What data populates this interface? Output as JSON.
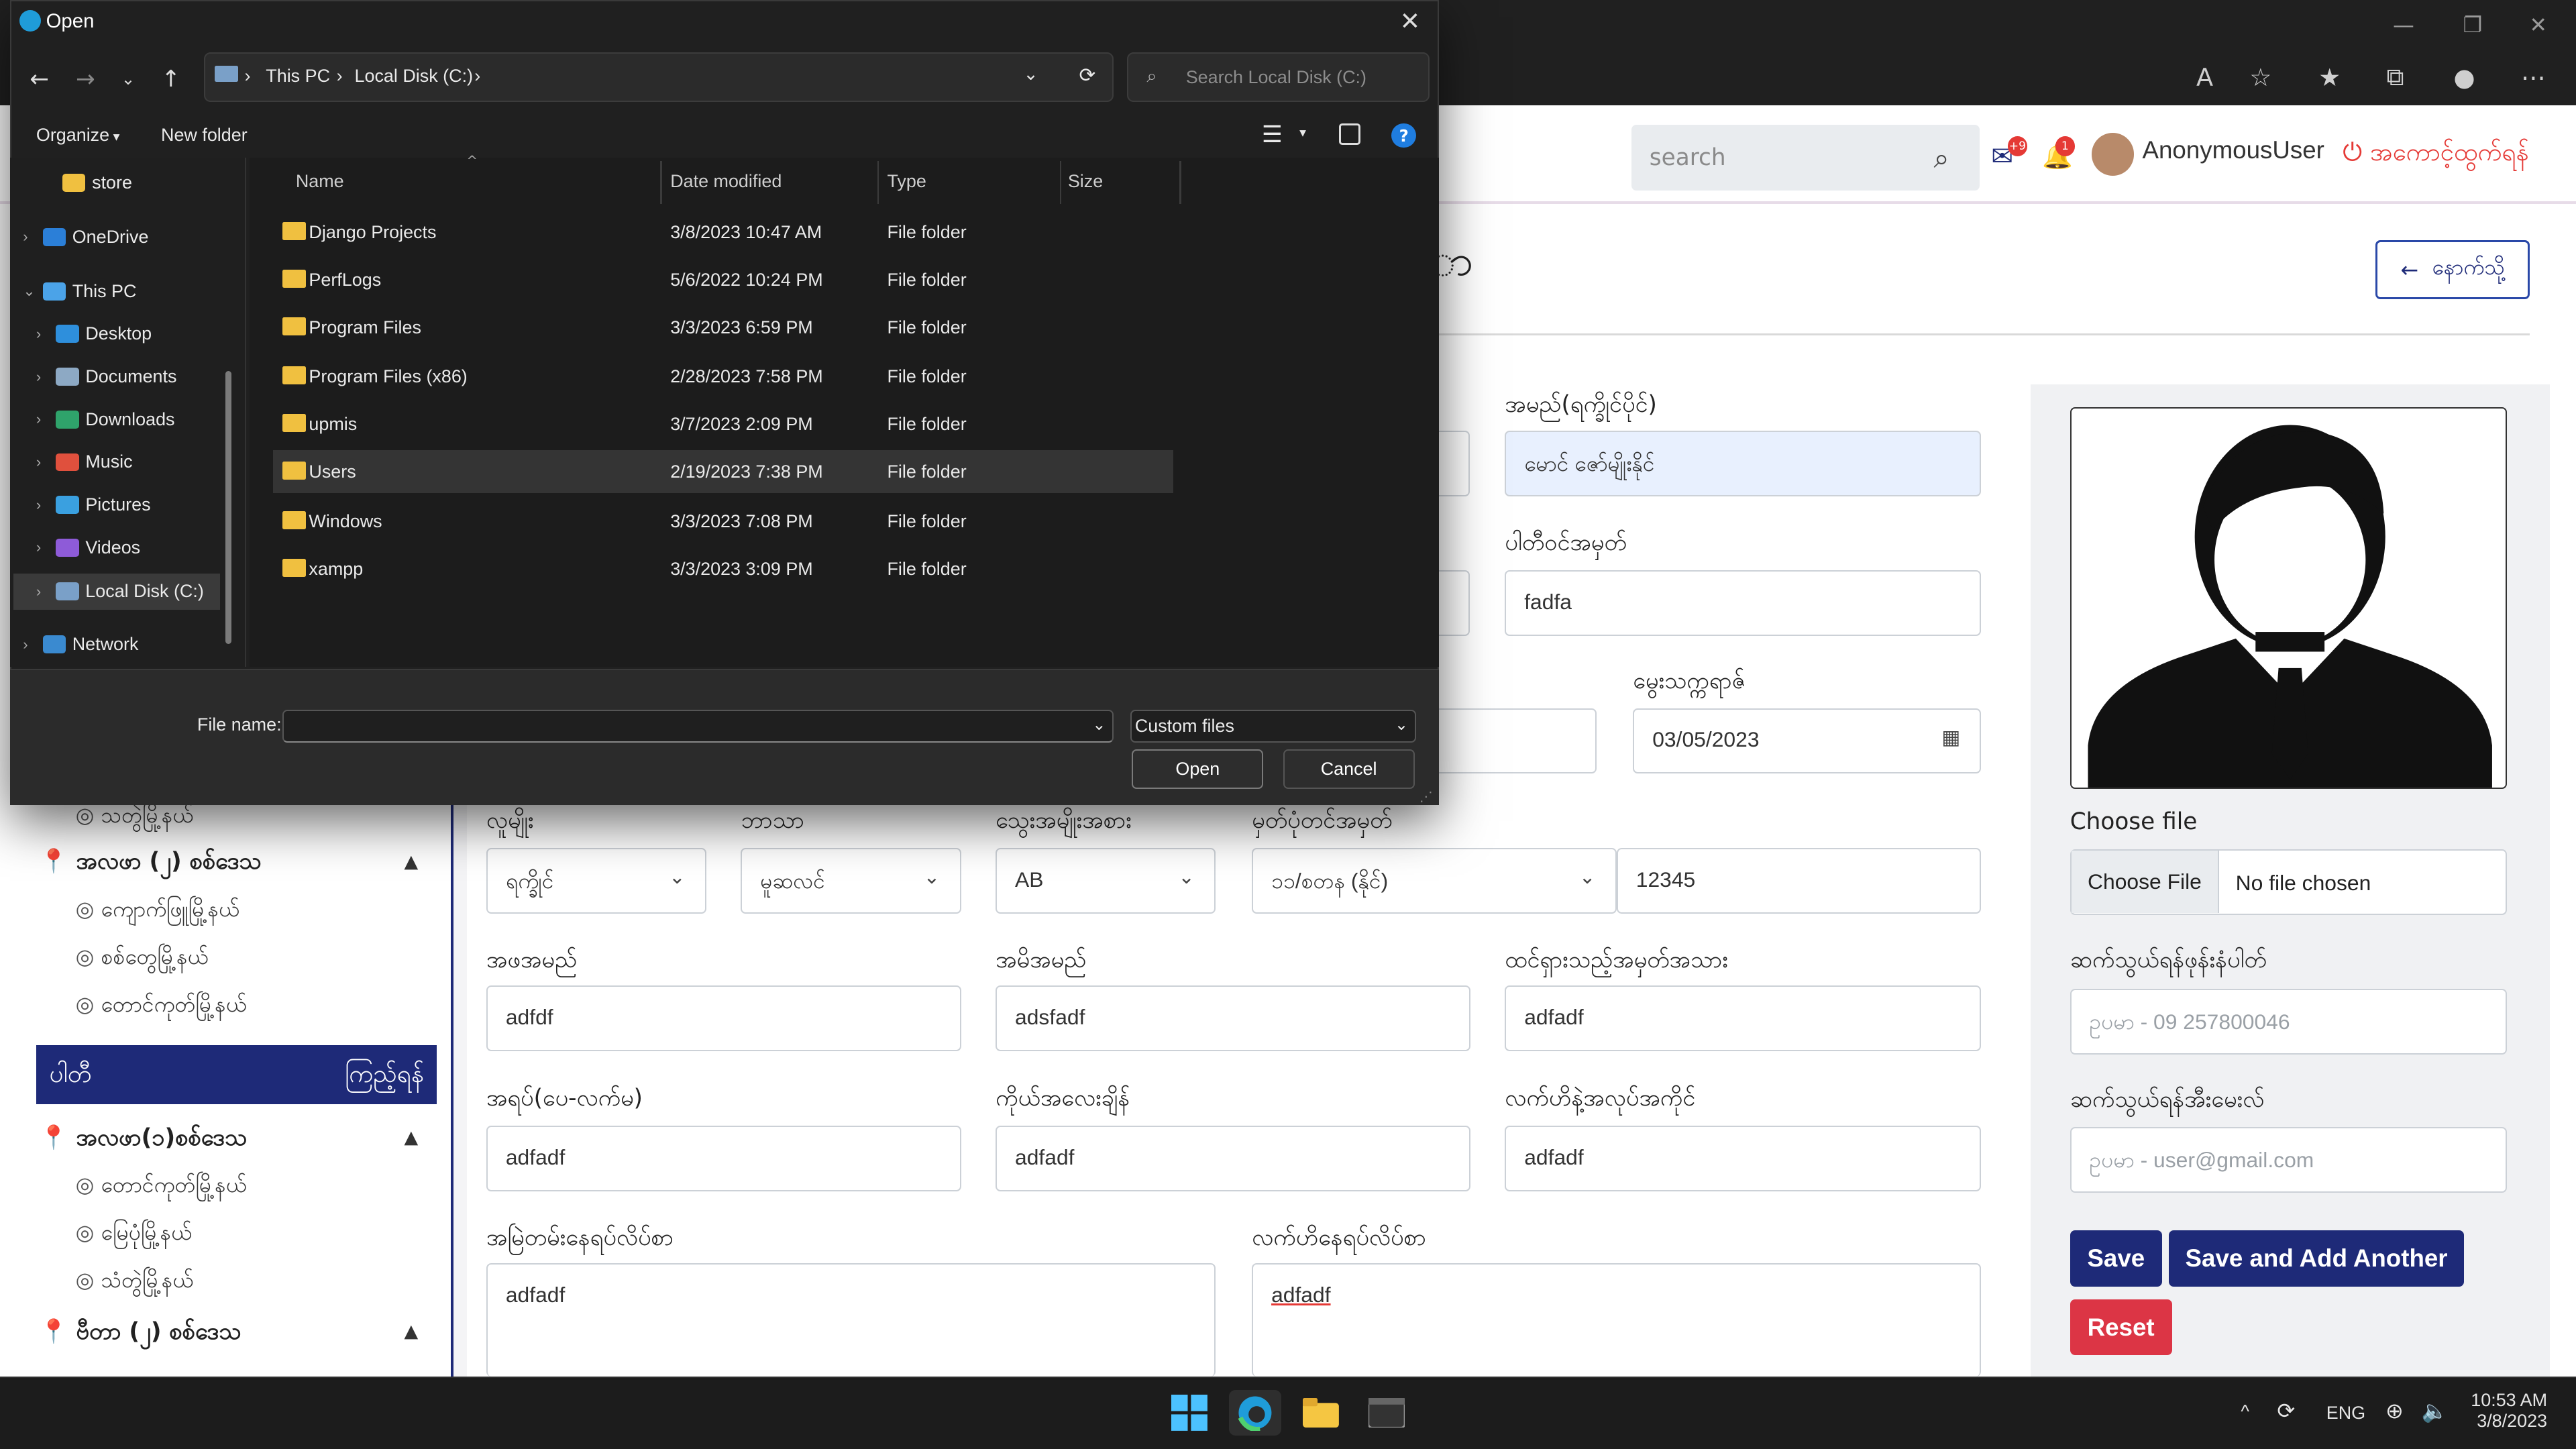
{
  "dialog": {
    "title": "Open",
    "breadcrumb": [
      "This PC",
      "Local Disk (C:)"
    ],
    "search_placeholder": "Search Local Disk (C:)",
    "organize": "Organize",
    "new_folder": "New folder",
    "nav": [
      {
        "label": "store"
      },
      {
        "label": "OneDrive"
      },
      {
        "label": "This PC"
      },
      {
        "label": "Desktop"
      },
      {
        "label": "Documents"
      },
      {
        "label": "Downloads"
      },
      {
        "label": "Music"
      },
      {
        "label": "Pictures"
      },
      {
        "label": "Videos"
      },
      {
        "label": "Local Disk (C:)"
      },
      {
        "label": "Network"
      }
    ],
    "columns": {
      "name": "Name",
      "date": "Date modified",
      "type": "Type",
      "size": "Size"
    },
    "files": [
      {
        "name": "Django Projects",
        "date": "3/8/2023 10:47 AM",
        "type": "File folder"
      },
      {
        "name": "PerfLogs",
        "date": "5/6/2022 10:24 PM",
        "type": "File folder"
      },
      {
        "name": "Program Files",
        "date": "3/3/2023 6:59 PM",
        "type": "File folder"
      },
      {
        "name": "Program Files (x86)",
        "date": "2/28/2023 7:58 PM",
        "type": "File folder"
      },
      {
        "name": "upmis",
        "date": "3/7/2023 2:09 PM",
        "type": "File folder"
      },
      {
        "name": "Users",
        "date": "2/19/2023 7:38 PM",
        "type": "File folder"
      },
      {
        "name": "Windows",
        "date": "3/3/2023 7:08 PM",
        "type": "File folder"
      },
      {
        "name": "xampp",
        "date": "3/3/2023 3:09 PM",
        "type": "File folder"
      }
    ],
    "file_name_label": "File name:",
    "file_name_value": "",
    "filter": "Custom files",
    "open_btn": "Open",
    "cancel_btn": "Cancel"
  },
  "topbar": {
    "search_placeholder": "search",
    "mail_badge": "+9",
    "bell_badge": "1",
    "user": "AnonymousUser",
    "logout": "အကောင့်ထွက်ရန်"
  },
  "back_btn": "နောက်သို့",
  "page_title_fragment": "ာ",
  "form": {
    "name_mm_label": "အမည်(ရက္ခိုင်ပိုင်)",
    "name_mm_value": "မောင် ဇော်မျိုးနိုင်",
    "passport_label": "ပါတီဝင်အမှတ်",
    "passport_value": "fadfa",
    "dob_label": "မွေးသက္ကရာဇ်",
    "dob_value": "03/05/2023",
    "race_label": "လူမျိုး",
    "race_value": "ရက္ခိုင်",
    "religion_label": "ဘာသာ",
    "religion_value": "မူဆလင်",
    "blood_label": "သွေးအမျိုးအစား",
    "blood_value": "AB",
    "nrc_label": "မှတ်ပုံတင်အမှတ်",
    "nrc_value": "၁၁/စတန (နိုင်)",
    "nrc_number": "12345",
    "father_label": "အဖအမည်",
    "father_value": "adfdf",
    "mother_label": "အမိအမည်",
    "mother_value": "adsfadf",
    "mark_label": "ထင်ရှားသည့်အမှတ်အသား",
    "mark_value": "adfadf",
    "education_label": "အရပ်(ပေ-လက်မ)",
    "education_value": "adfadf",
    "occupation_label": "ကိုယ်အလေးချိန်",
    "occupation_value": "adfadf",
    "work_label": "လက်ဟိနဲ့အလုပ်အကိုင်",
    "work_value": "adfadf",
    "perm_addr_label": "အမြဲတမ်းနေရပ်လိပ်စာ",
    "perm_addr_value": "adfadf",
    "curr_addr_label": "လက်ဟိနေရပ်လိပ်စာ",
    "curr_addr_value": "adfadf"
  },
  "photo": {
    "choose_label": "Choose file",
    "choose_btn": "Choose File",
    "no_file": "No file chosen",
    "phone_label": "ဆက်သွယ်ရန်ဖုန်းနံပါတ်",
    "phone_placeholder": "ဥပမာ - 09 257800046",
    "email_label": "ဆက်သွယ်ရန်အီးမေးလ်",
    "email_placeholder": "ဥပမာ - user@gmail.com",
    "save": "Save",
    "save_add": "Save and Add Another",
    "reset": "Reset"
  },
  "sidebar": {
    "top_item": "သတွဲမြို့နယ်",
    "group1": "အလဖာ (၂) စစ်ဒေသ",
    "group1_items": [
      "ကျောက်ဖြူမြို့နယ်",
      "စစ်တွေမြို့နယ်",
      "တောင်ကုတ်မြို့နယ်"
    ],
    "active_label": "ပါတီ",
    "active_action": "ကြည့်ရန်",
    "group2": "အလဖာ(၁)စစ်ဒေသ",
    "group2_items": [
      "တောင်ကုတ်မြို့နယ်",
      "မြေပုံမြို့နယ်",
      "သံတွဲမြို့နယ်"
    ],
    "group3": "ဗီတာ (၂) စစ်ဒေသ"
  },
  "taskbar": {
    "lang": "ENG",
    "time": "10:53 AM",
    "date": "3/8/2023"
  },
  "colors": {
    "primary": "#1e2a78",
    "danger": "#dc3545",
    "dialog_bg": "#202020"
  }
}
